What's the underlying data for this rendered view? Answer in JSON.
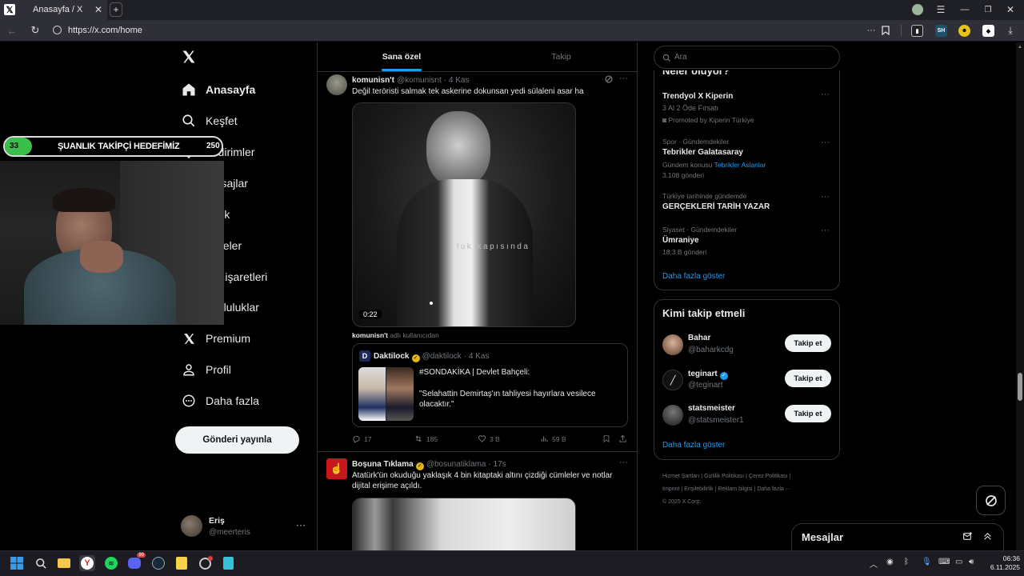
{
  "browser": {
    "tab_title": "Anasayfa / X",
    "url": "https://x.com/home",
    "ext_sh_label": "SH"
  },
  "nav": {
    "items": [
      {
        "label": "Anasayfa",
        "icon": "home-icon"
      },
      {
        "label": "Keşfet",
        "icon": "search-icon"
      },
      {
        "label": "Bildirimler",
        "icon": "bell-icon"
      },
      {
        "label": "Mesajlar",
        "icon": "mail-icon"
      },
      {
        "label": "Grok",
        "icon": "grok-icon"
      },
      {
        "label": "Listeler",
        "icon": "list-icon"
      },
      {
        "label": "Yer işaretleri",
        "icon": "bookmark-icon"
      },
      {
        "label": "Topluluklar",
        "icon": "people-icon"
      },
      {
        "label": "Premium",
        "icon": "x-icon"
      },
      {
        "label": "Profil",
        "icon": "person-icon"
      },
      {
        "label": "Daha fazla",
        "icon": "more-circle-icon"
      }
    ],
    "post_button": "Gönderi yayınla",
    "account": {
      "name": "Eriş",
      "handle": "@meerteris"
    }
  },
  "overlay": {
    "left_count": "33",
    "title": "ŞUANLIK TAKİPÇİ HEDEFİMİZ",
    "right_count": "250"
  },
  "feed": {
    "tabs": [
      {
        "label": "Sana özel",
        "active": true
      },
      {
        "label": "Takip",
        "active": false
      }
    ],
    "post1": {
      "name": "komunisn't",
      "handle": "@komunisnt",
      "time": "· 4 Kas",
      "text": "Değil teröristi salmak tek askerine dokunsan yedi sülaleni asar ha",
      "video_time": "0:22",
      "video_caption": "luk kapısında",
      "attribution_name": "komunisn't",
      "attribution_rest": "adlı kullanıcıdan",
      "quote": {
        "name": "Daktilock",
        "handle": "@daktilock",
        "time": "· 4 Kas",
        "line1": "#SONDAKİKA | Devlet Bahçeli:",
        "line2": "\"Selahattin Demirtaş'ın tahliyesi hayırlara vesilece olacaktır.\""
      },
      "replies": "17",
      "reposts": "185",
      "likes": "3 B",
      "views": "59 B"
    },
    "post2": {
      "name": "Boşuna Tıklama",
      "handle": "@bosunatiklama",
      "time": "· 17s",
      "text": "Atatürk'ün okuduğu yaklaşık 4 bin kitaptaki altını çizdiği cümleler ve notlar dijital erişime açıldı."
    }
  },
  "sidebar": {
    "search_placeholder": "Ara",
    "trends_heading": "Neler oluyor?",
    "trends": [
      {
        "meta": "",
        "title": "Trendyol X Kiperin",
        "sub": "3 Al 2 Öde Fırsatı",
        "promoted": "Promoted by Kiperin Türkiye"
      },
      {
        "meta": "Spor · Gündemdekiler",
        "title": "Tebrikler Galatasaray",
        "topic_prefix": "Gündem konusu",
        "topic_link": "Tebrikler Aslanlar",
        "count": "3.108 gönderi"
      },
      {
        "meta": "Türkiye tarihinde gündemde",
        "title": "GERÇEKLERİ TARİH YAZAR"
      },
      {
        "meta": "Siyaset · Gündemdekiler",
        "title": "Ümraniye",
        "count": "18,3 B gönderi"
      }
    ],
    "show_more": "Daha fazla göster",
    "who_to_follow": {
      "heading": "Kimi takip etmeli",
      "button": "Takip et",
      "users": [
        {
          "name": "Bahar",
          "handle": "@baharkcdg",
          "verified": false
        },
        {
          "name": "teginart",
          "handle": "@teginart",
          "verified": true
        },
        {
          "name": "statsmeister",
          "handle": "@statsmeister1",
          "verified": false
        }
      ],
      "show_more": "Daha fazla göster"
    },
    "footer": {
      "links": [
        "Hizmet Şartları",
        "Gizlilik Politikası",
        "Çerez Politikası",
        "Imprint",
        "Erişilebilirlik",
        "Reklam bilgisi",
        "Daha fazla ···"
      ],
      "copyright": "© 2025 X Corp."
    },
    "messages": "Mesajlar"
  },
  "taskbar": {
    "time": "06:36",
    "date": "6.11.2025",
    "discord_badge": "99"
  },
  "colors": {
    "accent": "#1d9bf0",
    "bg": "#000000",
    "border": "#2f3336",
    "overlay_green": "#3bbf4a"
  }
}
